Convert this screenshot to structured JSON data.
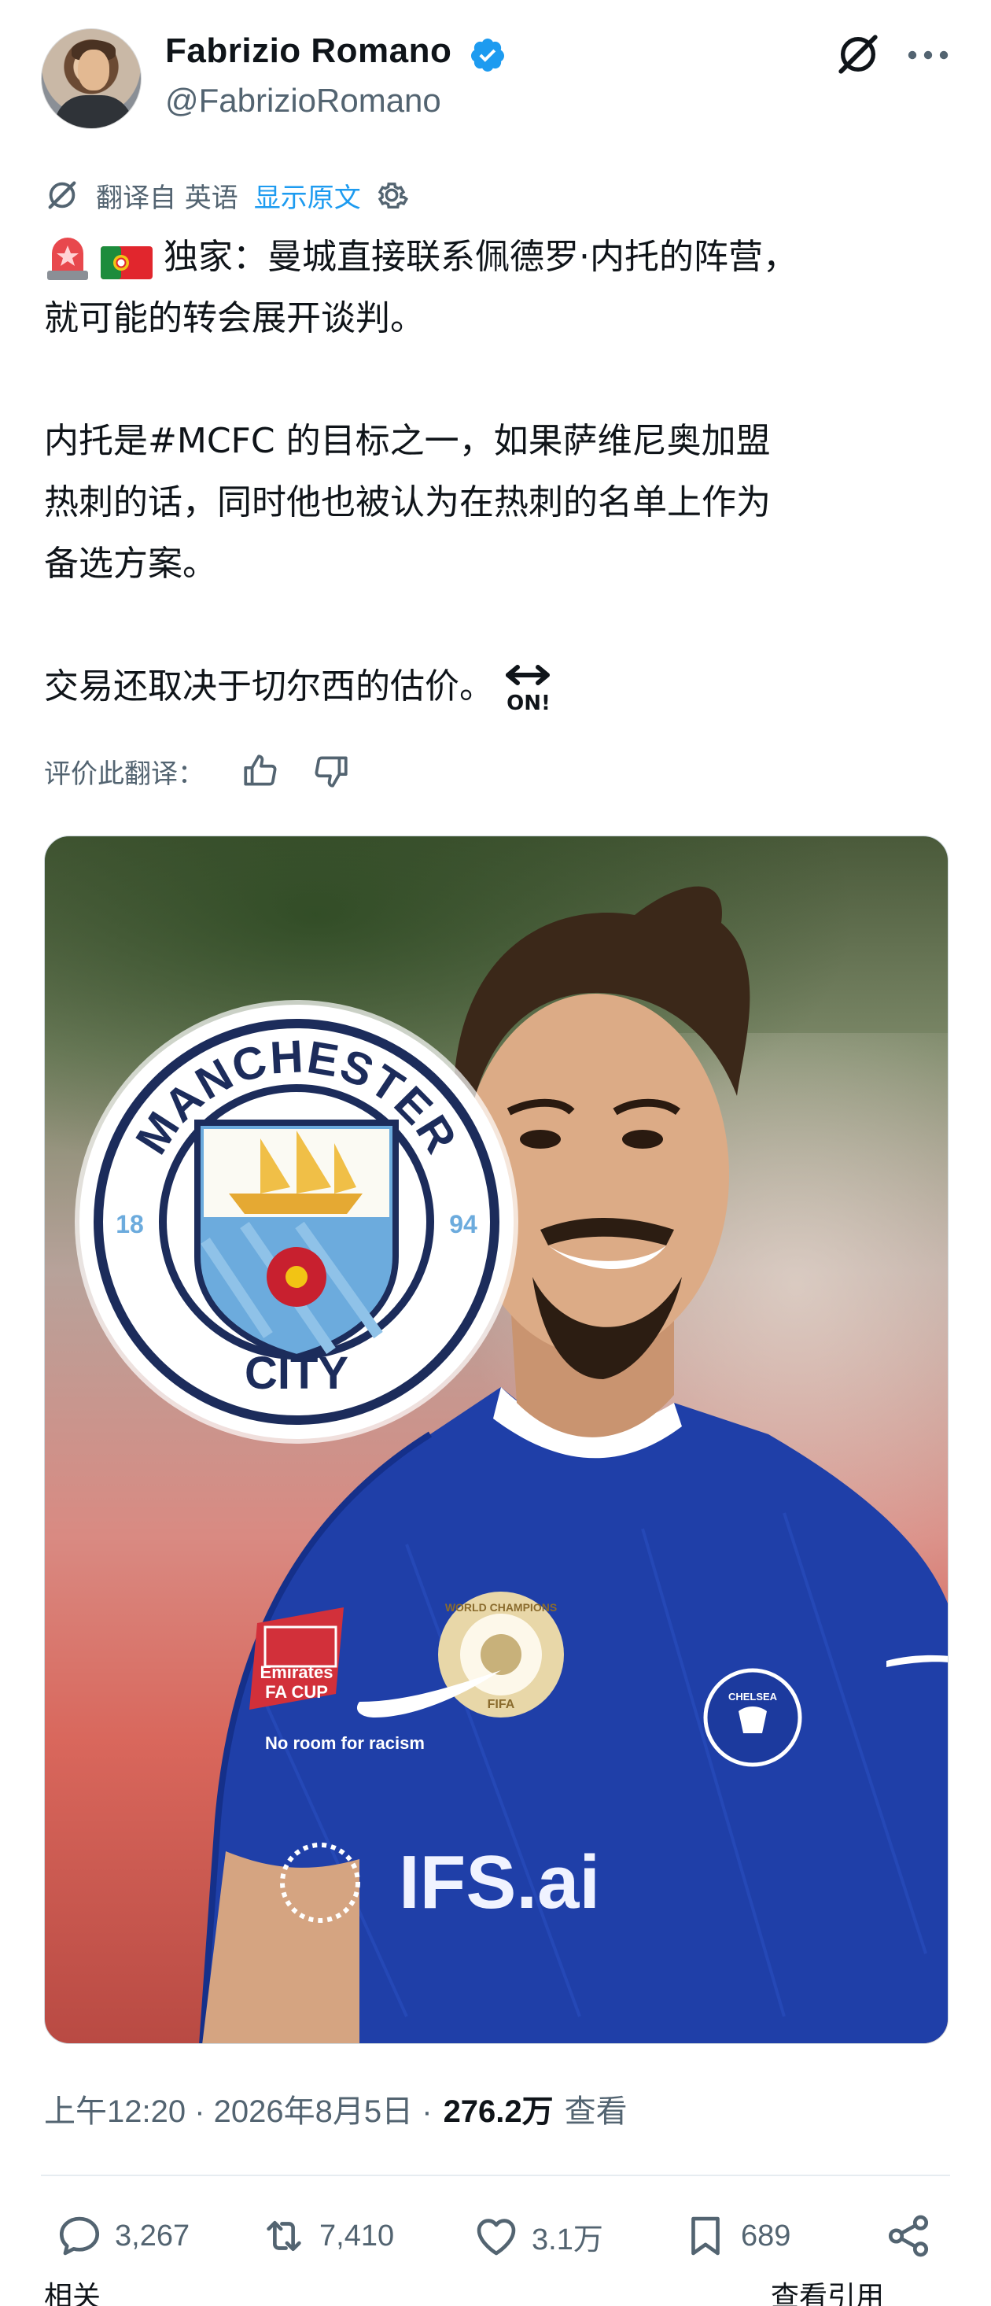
{
  "author": {
    "name": "Fabrizio Romano",
    "handle": "@FabrizioRomano",
    "verified": true
  },
  "translation": {
    "from_label": "翻译自 英语",
    "show_original": "显示原文"
  },
  "tweet": {
    "line1": "独家：曼城直接联系佩德罗·内托的阵营，",
    "line2": "就可能的转会展开谈判。",
    "line3": "内托是#MCFC 的目标之一，如果萨维尼奥加盟",
    "line4": "热刺的话，同时他也被认为在热刺的名单上作为",
    "line5": "备选方案。",
    "line6": "交易还取决于切尔西的估价。"
  },
  "rate": {
    "label": "评价此翻译："
  },
  "media": {
    "club_badge_top": "MANCHESTER",
    "club_badge_bottom": "CITY",
    "badge_year_left": "18",
    "badge_year_right": "94",
    "sleeve_patch": "Emirates FA CUP",
    "sleeve_patch_line1": "Emirates",
    "sleeve_patch_line2": "FA CUP",
    "sleeve_text": "No room for racism",
    "chest_badge": "WORLD CHAMPIONS",
    "chest_badge_sub": "FIFA",
    "crest_text": "CHELSEA",
    "sponsor_text": "IFS.ai"
  },
  "meta": {
    "time": "上午12:20 · 2026年8月5日 · ",
    "views": "276.2万",
    "views_label": "查看"
  },
  "actions": {
    "replies": "3,267",
    "reposts": "7,410",
    "likes": "3.1万",
    "bookmarks": "689"
  },
  "bottom": {
    "left_cut": "相关",
    "right_cut": "查看引用"
  },
  "colors": {
    "blue": "#1d9bf0",
    "text": "#0f1419",
    "secondary": "#536471",
    "city_blue": "#6cabdd",
    "chelsea_blue": "#1f3fa8"
  }
}
